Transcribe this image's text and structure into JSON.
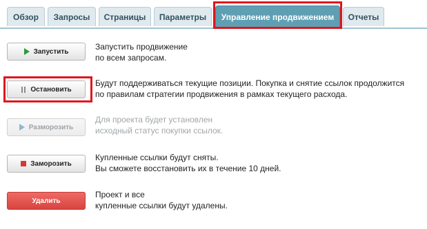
{
  "tabs": [
    {
      "label": "Обзор",
      "active": false
    },
    {
      "label": "Запросы",
      "active": false
    },
    {
      "label": "Страницы",
      "active": false
    },
    {
      "label": "Параметры",
      "active": false
    },
    {
      "label": "Управление продвижением",
      "active": true
    },
    {
      "label": "Отчеты",
      "active": false
    }
  ],
  "actions": {
    "start": {
      "label": "Запустить",
      "icon": "play-icon",
      "enabled": true,
      "desc_line1": "Запустить продвижение",
      "desc_line2": "по всем запросам."
    },
    "stop": {
      "label": "Остановить",
      "icon": "pause-icon",
      "enabled": true,
      "desc_line1": "Будут поддерживаться текущие позиции. Покупка и снятие ссылок продолжится",
      "desc_line2": "по правилам стратегии продвижения в рамках текущего расхода."
    },
    "unfreeze": {
      "label": "Разморозить",
      "icon": "play-icon",
      "enabled": false,
      "desc_line1": "Для проекта будет установлен",
      "desc_line2": "исходный статус покупки ссылок."
    },
    "freeze": {
      "label": "Заморозить",
      "icon": "stop-icon",
      "enabled": true,
      "desc_line1": "Купленные ссылки будут сняты.",
      "desc_line2": "Вы сможете восстановить их в течение 10 дней."
    },
    "delete": {
      "label": "Удалить",
      "enabled": true,
      "desc_line1": "Проект и все",
      "desc_line2": "купленные ссылки будут удалены."
    }
  },
  "colors": {
    "accent_tab": "#5f9fb3",
    "highlight": "#e0141c",
    "start_icon": "#2a9c3a",
    "delete_button": "#d8443f"
  }
}
